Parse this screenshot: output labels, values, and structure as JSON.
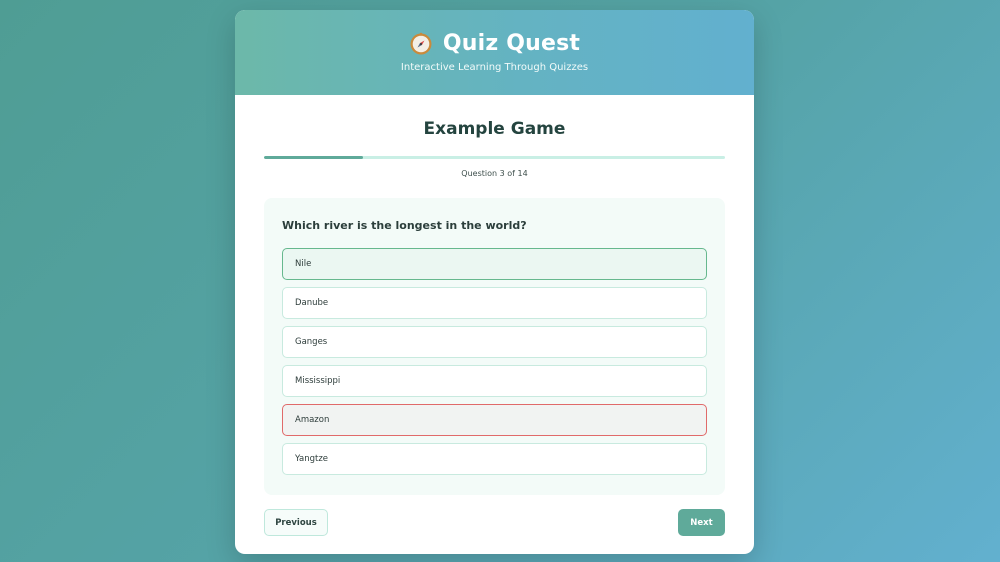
{
  "header": {
    "title": "Quiz Quest",
    "tagline": "Interactive Learning Through Quizzes",
    "icon": "compass-icon"
  },
  "game": {
    "title": "Example Game",
    "progress_text": "Question 3 of 14",
    "progress_fraction": 0.214
  },
  "question": {
    "text": "Which river is the longest in the world?",
    "options": [
      {
        "label": "Nile",
        "state": "correct"
      },
      {
        "label": "Danube",
        "state": "neutral"
      },
      {
        "label": "Ganges",
        "state": "neutral"
      },
      {
        "label": "Mississippi",
        "state": "neutral"
      },
      {
        "label": "Amazon",
        "state": "wrong"
      },
      {
        "label": "Yangtze",
        "state": "neutral"
      }
    ]
  },
  "nav": {
    "previous_label": "Previous",
    "next_label": "Next"
  },
  "colors": {
    "accent": "#5faa9a",
    "correct_border": "#66b88e",
    "wrong_border": "#e06a6a"
  }
}
